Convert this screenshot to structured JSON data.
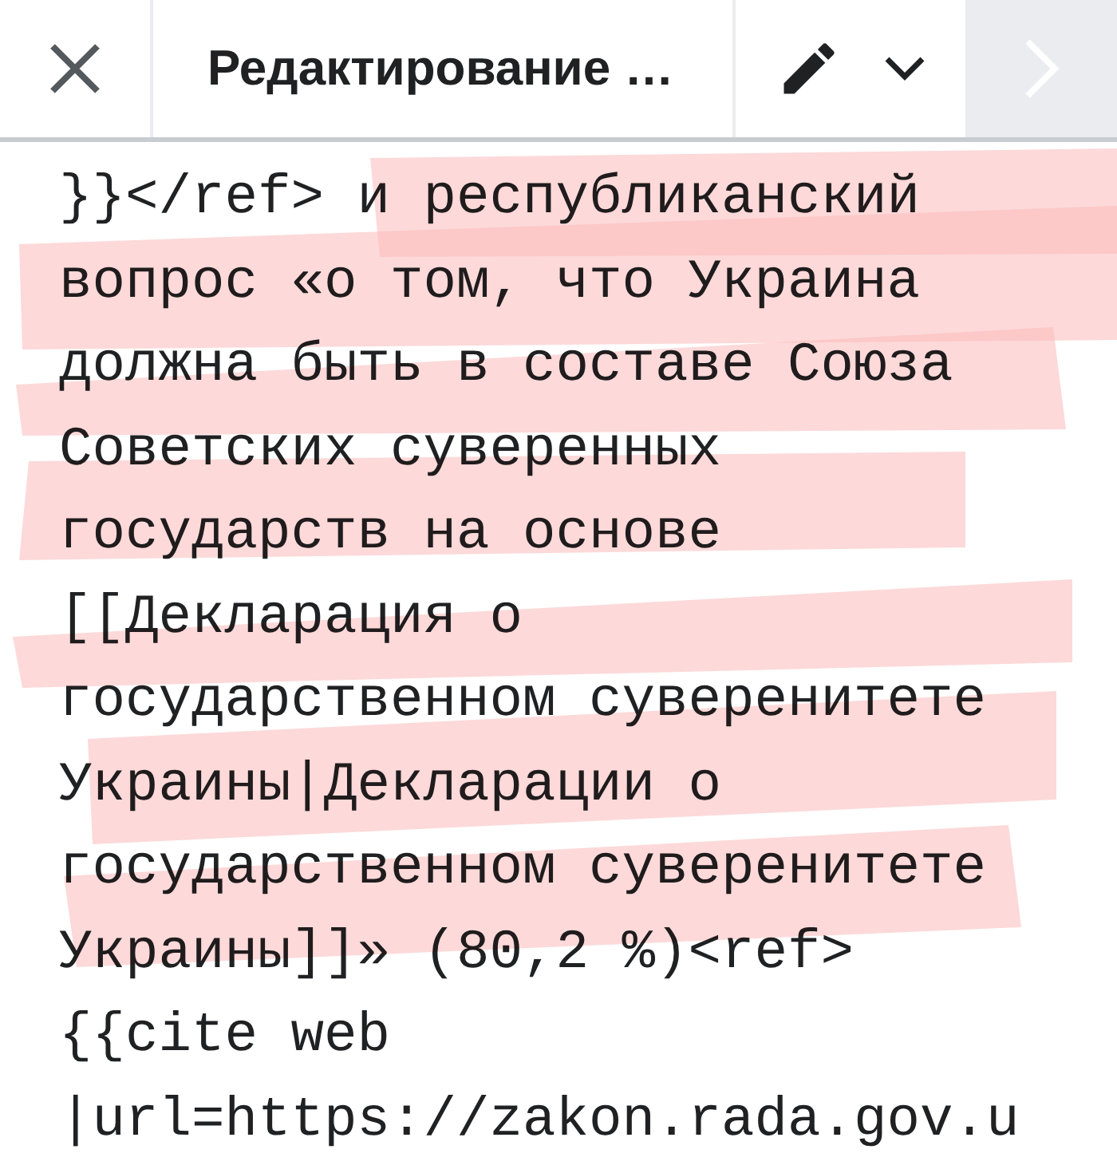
{
  "toolbar": {
    "title": "Редактирование …"
  },
  "editor": {
    "lines": [
      "}}</ref> и республиканский",
      "вопрос «о том, что Украина",
      "должна быть в составе Союза",
      "Советских суверенных",
      "государств на основе",
      "[[Декларация о",
      "государственном суверенитете",
      "Украины|Декларации о",
      "государственном суверенитете",
      "Украины]]» (80,2 %)<ref>",
      "{{cite web",
      "|url=https://zakon.rada.gov.u"
    ]
  }
}
